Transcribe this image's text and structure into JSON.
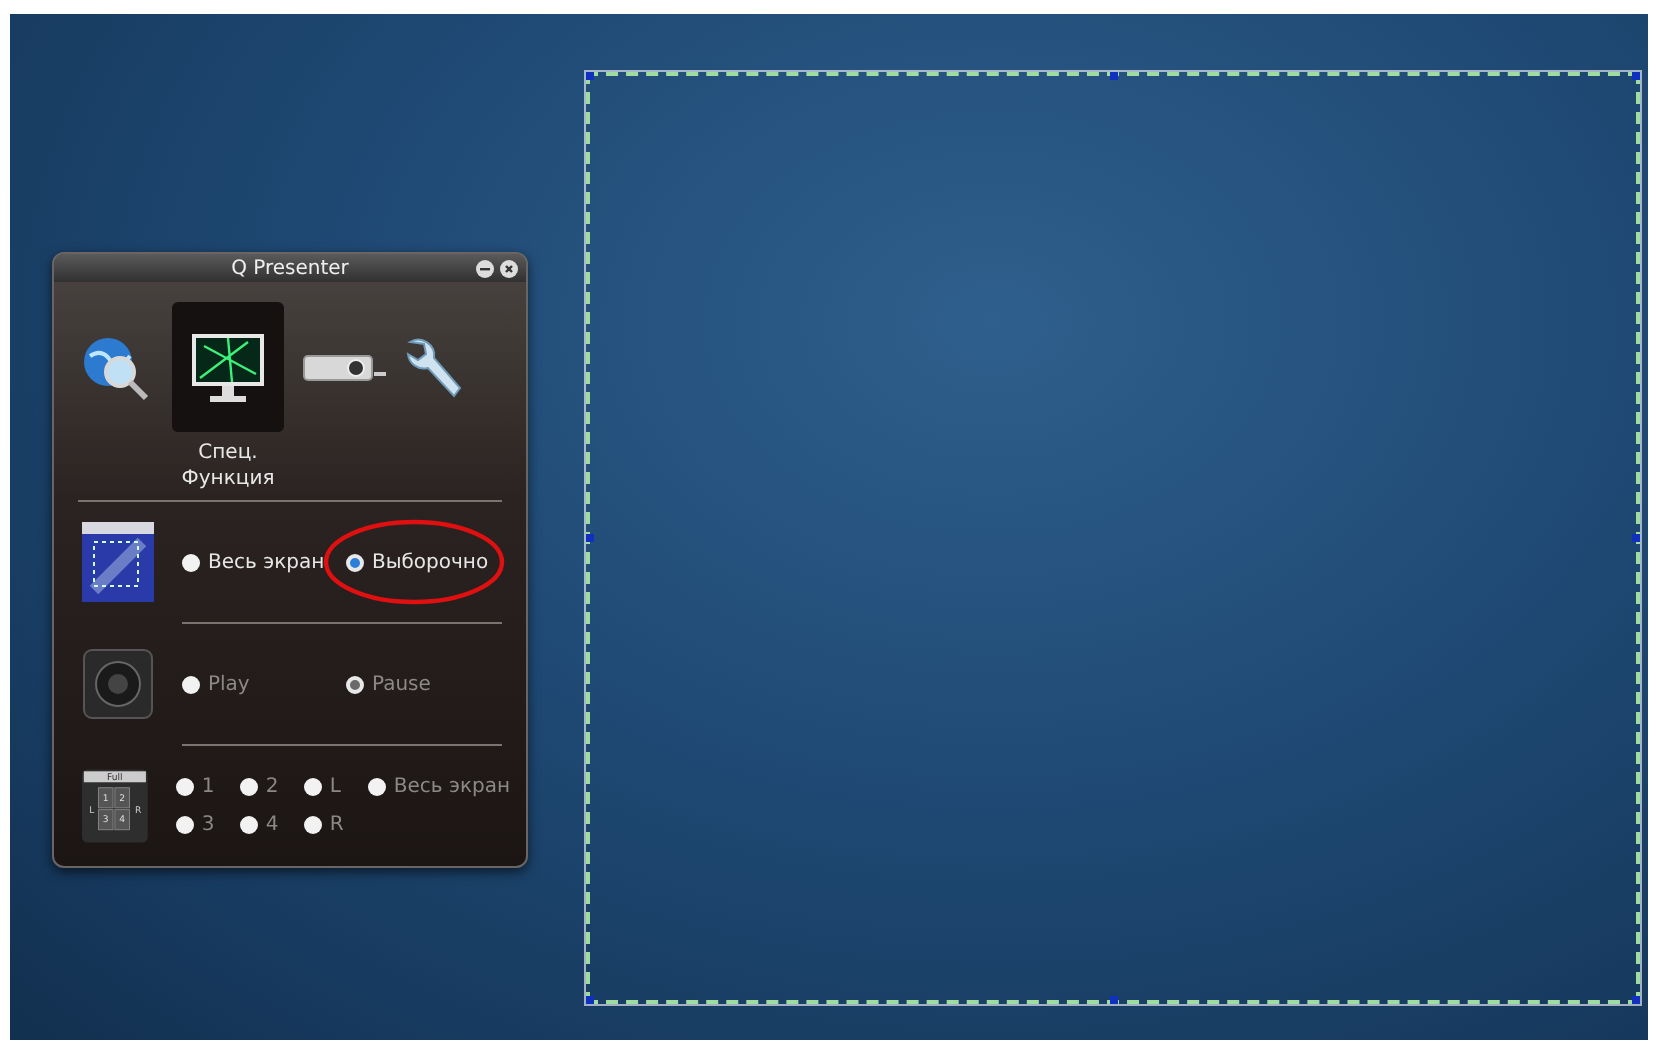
{
  "window": {
    "title": "Q Presenter"
  },
  "toolbar": [
    {
      "kind": "search",
      "selected": false
    },
    {
      "kind": "display",
      "selected": true,
      "label": "Спец. Функция"
    },
    {
      "kind": "projector",
      "selected": false
    },
    {
      "kind": "settings",
      "selected": false
    }
  ],
  "sections": [
    {
      "kind": "capture",
      "options": [
        {
          "label": "Весь экран",
          "selected": false,
          "disabled": false,
          "circled": false
        },
        {
          "label": "Выборочно",
          "selected": true,
          "disabled": false,
          "circled": true
        }
      ]
    },
    {
      "kind": "playback",
      "options": [
        {
          "label": "Play",
          "selected": false,
          "disabled": true,
          "circled": false
        },
        {
          "label": "Pause",
          "selected": true,
          "disabled": true,
          "circled": false
        }
      ]
    },
    {
      "kind": "layout",
      "icon_labels": {
        "top": "Full",
        "cells": [
          "1",
          "2",
          "3",
          "4"
        ],
        "left": "L",
        "right": "R"
      },
      "options": [
        {
          "label": "1",
          "selected": false,
          "disabled": true,
          "circled": false
        },
        {
          "label": "2",
          "selected": false,
          "disabled": true,
          "circled": false
        },
        {
          "label": "L",
          "selected": false,
          "disabled": true,
          "circled": false
        },
        {
          "label": "Весь экран",
          "selected": false,
          "disabled": true,
          "circled": false
        },
        {
          "label": "3",
          "selected": false,
          "disabled": true,
          "circled": false
        },
        {
          "label": "4",
          "selected": false,
          "disabled": true,
          "circled": false
        },
        {
          "label": "R",
          "selected": false,
          "disabled": true,
          "circled": false
        }
      ]
    }
  ]
}
